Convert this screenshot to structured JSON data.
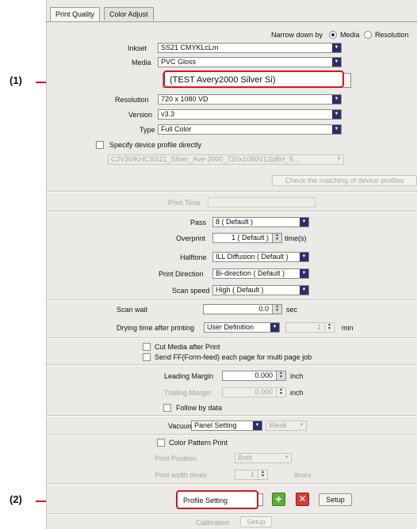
{
  "callouts": {
    "c1": "(1)",
    "c2": "(2)"
  },
  "tabs": [
    "Print Quality",
    "Color Adjust"
  ],
  "narrow": {
    "label": "Narrow down by",
    "opt1": "Media",
    "opt2": "Resolution",
    "selected": "Media"
  },
  "inkset": {
    "label": "Inkset",
    "value": "SS21 CMYKLcLm"
  },
  "media": {
    "label": "Media",
    "value": "PVC Gloss",
    "profile_popup": "(TEST Avery2000 Silver Si)"
  },
  "resolution": {
    "label": "Resolution",
    "value": "720 x 1080 VD"
  },
  "version": {
    "label": "Version",
    "value": "v3.3"
  },
  "type": {
    "label": "Type",
    "value": "Full Color"
  },
  "device_profile": {
    "label": "Specify device profile directly",
    "value": "CJV30/KHCSS21_Silver_Ave-2000_720x1080V12pBH_9...",
    "check_button": "Check the matching of device profiles"
  },
  "print_time": {
    "label": "Print Time"
  },
  "pass": {
    "label": "Pass",
    "value": "8 ( Default )"
  },
  "overprint": {
    "label": "Overprint",
    "value": "1 ( Default )",
    "unit": "time(s)"
  },
  "halftone": {
    "label": "Halftone",
    "value": "ILL Diffusion ( Default )"
  },
  "direction": {
    "label": "Print Direction",
    "value": "Bi-direction ( Default )"
  },
  "scan_speed": {
    "label": "Scan speed",
    "value": "High ( Default )"
  },
  "scan_wait": {
    "label": "Scan wait",
    "value": "0.0",
    "unit": "sec"
  },
  "drying": {
    "label": "Drying time after printing",
    "value": "User Definition",
    "number": "1",
    "unit": "min"
  },
  "cut_media": {
    "label": "Cut Media after Print"
  },
  "send_ff": {
    "label": "Send FF(Form-feed) each page for multi page job"
  },
  "leading": {
    "label": "Leading Margin",
    "value": "0.000",
    "unit": "inch"
  },
  "trailing": {
    "label": "Trailing Margin",
    "value": "0.000",
    "unit": "inch"
  },
  "follow": {
    "label": "Follow by data"
  },
  "vacuum": {
    "label": "Vacuum",
    "value": "Panel Setting",
    "second": "Weak"
  },
  "color_pattern": {
    "label": "Color Pattern Print",
    "position_label": "Print Position",
    "position_value": "Both",
    "width_label": "Print width times",
    "width_value": "1",
    "width_unit": "times"
  },
  "profile": {
    "value": "Profile Setting",
    "setup": "Setup"
  },
  "bottom": {
    "calibration": "Calibration",
    "setup": "Setup"
  },
  "colors": {
    "accent_red": "#d4161f",
    "add_green": "#5cb030",
    "remove_red": "#d63a3a",
    "combo_arrow": "#2a2f6a"
  }
}
